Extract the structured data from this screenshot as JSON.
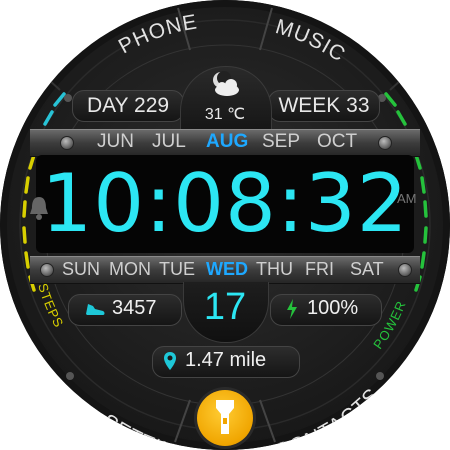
{
  "complications": {
    "phone": "PHONE",
    "music": "MUSIC",
    "settings": "SETTINGS",
    "contacts": "CONTACTS",
    "steps_arc_label": "STEPS",
    "power_arc_label": "POWER"
  },
  "info": {
    "day_of_year": "DAY 229",
    "week": "WEEK 33",
    "temperature": "31 ℃",
    "weather_icon": "partly-cloudy-night-icon"
  },
  "months": [
    "JUN",
    "JUL",
    "AUG",
    "SEP",
    "OCT"
  ],
  "active_month": "AUG",
  "time": {
    "display": "10:08:32",
    "ampm": "AM"
  },
  "weekdays": [
    "SUN",
    "MON",
    "TUE",
    "WED",
    "THU",
    "FRI",
    "SAT"
  ],
  "active_weekday": "WED",
  "date": "17",
  "steps": "3457",
  "battery": "100%",
  "distance": "1.47 mile",
  "icons": {
    "alarm": "bell-icon",
    "steps": "shoe-icon",
    "battery": "lightning-bolt-icon",
    "location": "location-pin-icon",
    "flashlight": "flashlight-icon"
  },
  "colors": {
    "time": "#2ce6f3",
    "active": "#1ea8ff",
    "steps_accent": "#d8cf00",
    "power_accent": "#25c23c",
    "gauge_cyan": "#28c3d6",
    "flashlight": "#f5b400"
  }
}
